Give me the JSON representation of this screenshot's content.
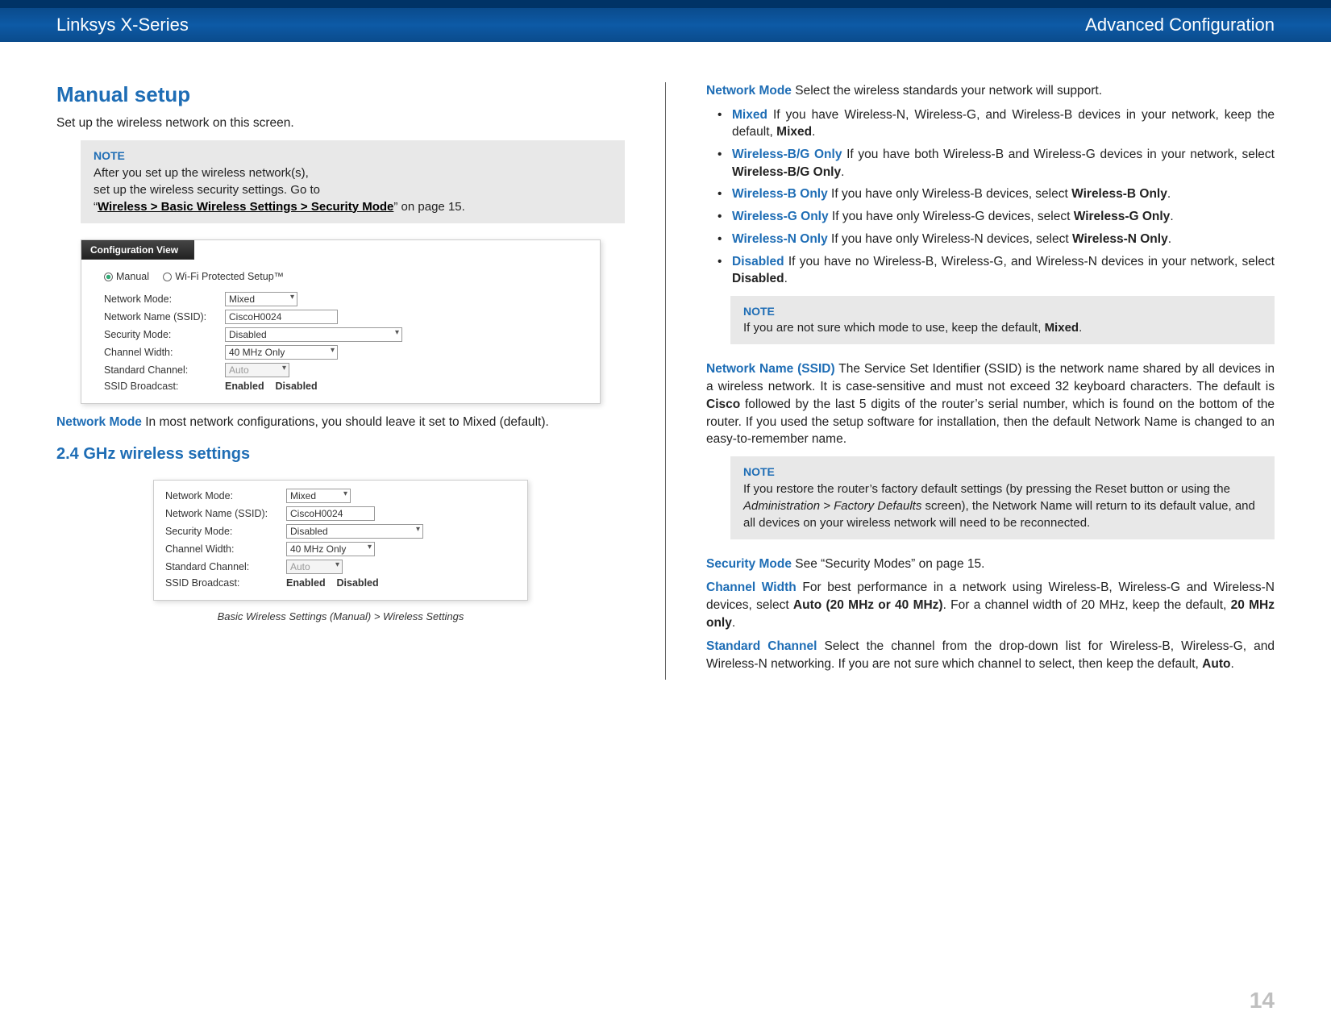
{
  "header": {
    "product": "Linksys X-Series",
    "section": "Advanced Configuration"
  },
  "left": {
    "h2": "Manual setup",
    "intro": "Set up the wireless network on this screen.",
    "note": {
      "title": "NOTE",
      "line1": "After you set up the wireless network(s),",
      "line2": "set up the wireless security settings. Go to",
      "line3_prefix": "“",
      "link": "Wireless > Basic Wireless Settings > Security Mode",
      "line3_suffix": "” on page 15."
    },
    "cfgview_tab": "Configuration View",
    "radios": {
      "manual": "Manual",
      "wps": "Wi-Fi Protected Setup™"
    },
    "fields": {
      "network_mode": {
        "label": "Network Mode:",
        "value": "Mixed"
      },
      "ssid": {
        "label": "Network Name (SSID):",
        "value": "CiscoH0024"
      },
      "security_mode": {
        "label": "Security Mode:",
        "value": "Disabled"
      },
      "channel_width": {
        "label": "Channel Width:",
        "value": "40 MHz Only"
      },
      "standard_channel": {
        "label": "Standard Channel:",
        "value": "Auto"
      },
      "ssid_broadcast": {
        "label": "SSID Broadcast:",
        "enabled": "Enabled",
        "disabled": "Disabled"
      }
    },
    "netmode_para": {
      "term": "Network Mode",
      "text": "  In most network configurations, you should leave it set to Mixed (default)."
    },
    "h3": "2.4 GHz wireless settings",
    "figcap": "Basic Wireless Settings (Manual) > Wireless Settings"
  },
  "right": {
    "netmode": {
      "term": "Network Mode",
      "text": "  Select the wireless standards your network will support."
    },
    "modes": [
      {
        "term": "Mixed",
        "text": "  If you have Wireless-N, Wireless-G, and Wireless-B devices in your network, keep the default, ",
        "bold": "Mixed",
        "after": "."
      },
      {
        "term": "Wireless-B/G Only",
        "text": "  If you have both Wireless-B and Wireless-G devices in your network, select ",
        "bold": "Wireless-B/G Only",
        "after": "."
      },
      {
        "term": "Wireless-B Only",
        "text": "  If you have only Wireless-B devices, select ",
        "bold": "Wireless-B Only",
        "after": "."
      },
      {
        "term": "Wireless-G Only",
        "text": "  If you have only Wireless-G devices, select ",
        "bold": "Wireless-G Only",
        "after": "."
      },
      {
        "term": "Wireless-N Only",
        "text": "  If you have only Wireless-N devices, select ",
        "bold": "Wireless-N Only",
        "after": "."
      },
      {
        "term": "Disabled",
        "text": "  If you have no Wireless-B, Wireless-G, and Wireless-N devices in your network, select ",
        "bold": "Disabled",
        "after": "."
      }
    ],
    "note1": {
      "title": "NOTE",
      "text": "If you are not sure which mode to use, keep the default, ",
      "bold": "Mixed",
      "after": "."
    },
    "ssid": {
      "term": "Network Name (SSID)",
      "text": "  The Service Set Identifier (SSID) is the network name shared by all devices in a wireless network. It is case-sensitive and must not exceed 32 keyboard characters. The default is ",
      "bold": "Cisco",
      "text2": " followed by the last 5 digits of the router’s serial number, which is found on the bottom of the router. If you used the setup software for installation, then the default Network Name is changed to an easy-to-remember name."
    },
    "note2": {
      "title": "NOTE",
      "text1": "If you restore the router’s factory default settings (by pressing the Reset button or using the ",
      "italic": "Administration > Factory Defaults",
      "text2": " screen), the Network Name will return to its default value, and all devices on your wireless network will need to be reconnected."
    },
    "security": {
      "term": "Security Mode",
      "text": "  See “Security Modes” on page 15."
    },
    "channelwidth": {
      "term": "Channel Width",
      "text1": "   For best performance in a network using Wireless-B, Wireless-G and Wireless-N devices, select ",
      "bold1": "Auto (20 MHz or 40 MHz)",
      "text2": ". For a channel width of 20 MHz, keep the default, ",
      "bold2": "20 MHz only",
      "after": "."
    },
    "stdchannel": {
      "term": "Standard Channel",
      "text1": "  Select the channel from the drop-down list for Wireless-B, Wireless-G, and Wireless-N networking. If you are not sure which channel to select, then keep the default, ",
      "bold": "Auto",
      "after": "."
    }
  },
  "pagenum": "14"
}
